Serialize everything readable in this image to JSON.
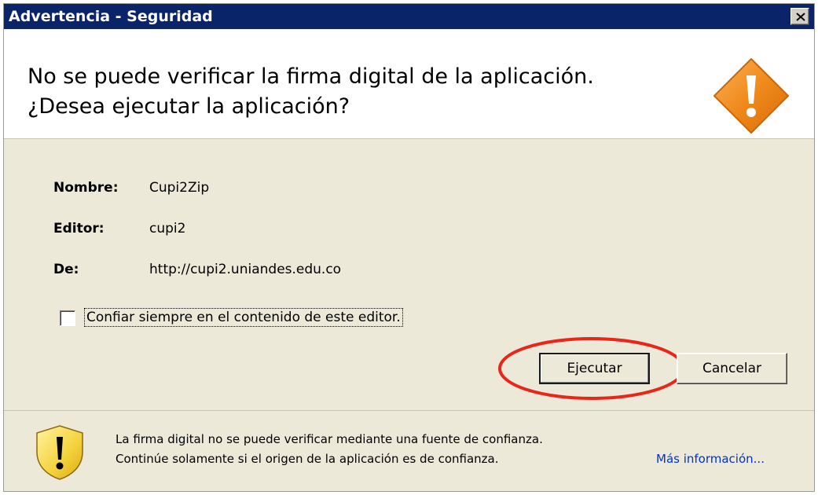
{
  "window": {
    "title": "Advertencia - Seguridad"
  },
  "header": {
    "line1": "No se puede verificar la firma digital de la aplicación.",
    "line2": "¿Desea ejecutar la aplicación?"
  },
  "details": {
    "name_label": "Nombre:",
    "name_value": "Cupi2Zip",
    "publisher_label": "Editor:",
    "publisher_value": "cupi2",
    "from_label": "De:",
    "from_value": "http://cupi2.uniandes.edu.co"
  },
  "checkbox": {
    "label": "Confiar siempre en el contenido de este editor.",
    "checked": false
  },
  "buttons": {
    "run": "Ejecutar",
    "cancel": "Cancelar"
  },
  "footer": {
    "line1": "La firma digital no se puede verificar mediante una fuente de confianza.",
    "line2": "Continúe solamente si el origen de la aplicación es de confianza.",
    "more_info": "Más información..."
  },
  "colors": {
    "titlebar": "#0a246a",
    "dialog_bg": "#ece9d8",
    "warning_orange": "#f08a1c",
    "shield_yellow": "#f4d23c",
    "annotation_red": "#e8261a",
    "link_blue": "#0033cc"
  },
  "icons": {
    "header": "warning-diamond-icon",
    "footer": "shield-warning-icon",
    "close": "close-icon"
  }
}
